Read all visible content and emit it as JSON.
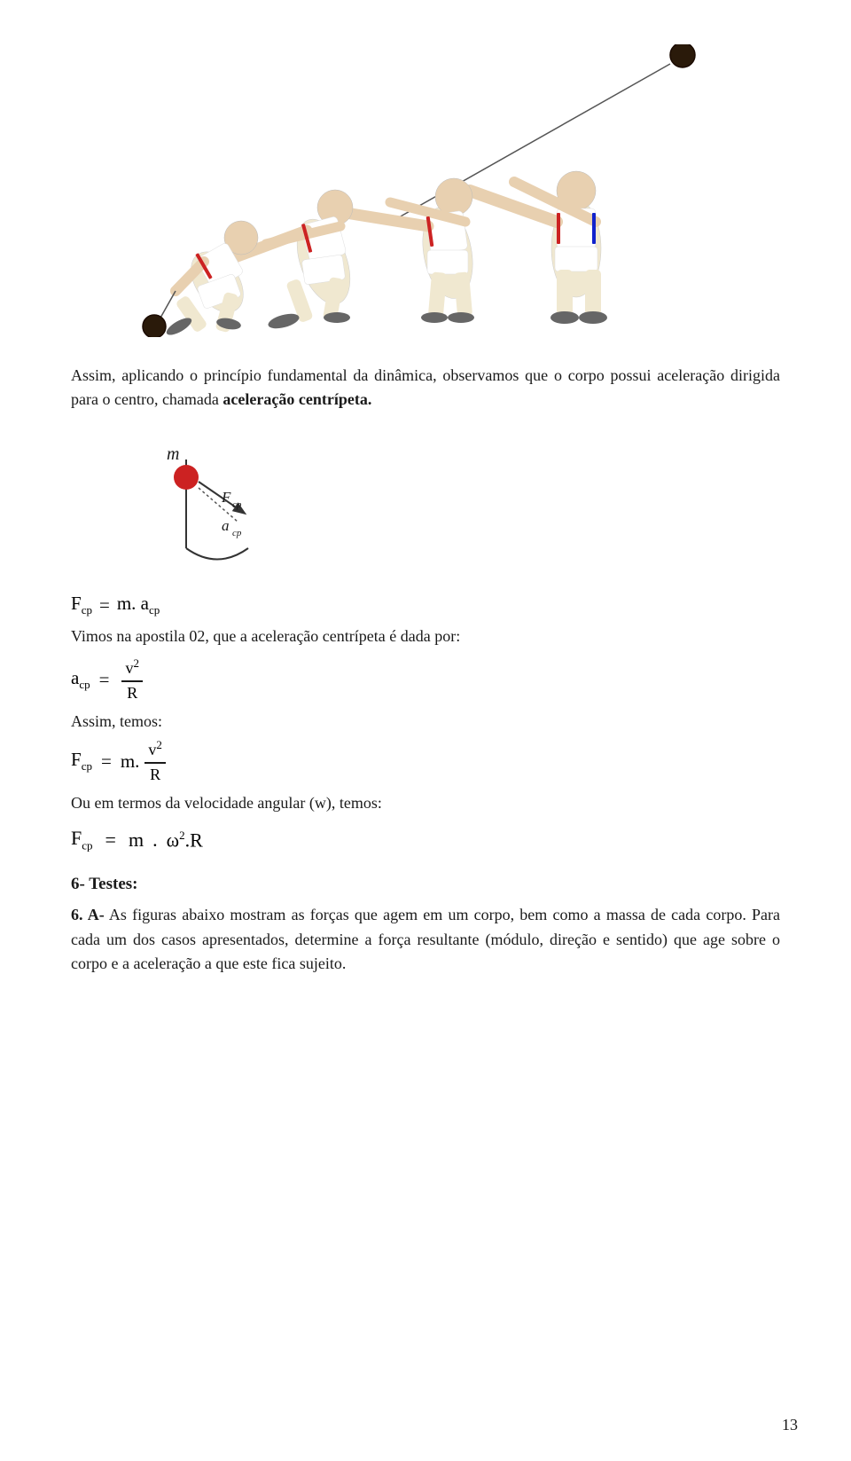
{
  "page": {
    "number": "13",
    "background": "#ffffff"
  },
  "image": {
    "alt": "Hammer throw athlete sequence showing circular motion",
    "description": "Multiple exposure photo of hammer throw athletes in sequence"
  },
  "intro": {
    "text": "Assim, aplicando o princípio fundamental da dinâmica, observamos que o corpo possui aceleração dirigida para o centro, chamada ",
    "bold_part": "aceleração centrípeta."
  },
  "diagram": {
    "m_label": "m",
    "fcp_label": "F",
    "fcp_sub": "cp",
    "acp_label": "a",
    "acp_sub": "cp"
  },
  "formulas": {
    "f_eq_ma": "F_cp = m. a_cp",
    "apostila_text": "Vimos na apostila 02, que a aceleração centrípeta é dada por:",
    "acp_eq": "a_cp = v² / R",
    "assim_temos": "Assim, temos:",
    "fcp_eq": "F_cp = m. v² / R",
    "velocidade_text": "Ou em termos da velocidade angular (w), temos:",
    "omega_eq": "F_cp = m . ω².R"
  },
  "section6": {
    "heading": "6- Testes:",
    "item_6a_label": "6. A-",
    "item_6a_text": "  As figuras abaixo mostram as forças que agem em um corpo, bem como a massa de cada corpo. Para cada um dos casos apresentados, determine a força resultante (módulo, direção e sentido) que age sobre o corpo e a aceleração a que este fica sujeito."
  }
}
